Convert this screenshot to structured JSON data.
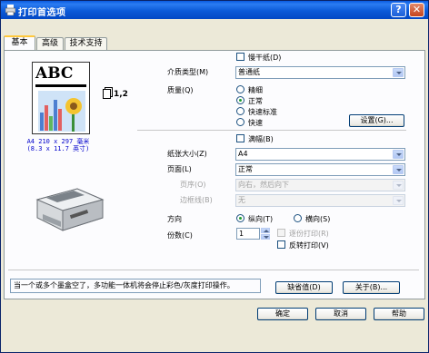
{
  "window": {
    "title": "打印首选项",
    "help_glyph": "?",
    "close_glyph": "✕"
  },
  "tabs": [
    {
      "label": "基本",
      "active": true
    },
    {
      "label": "高级"
    },
    {
      "label": "技术支持"
    }
  ],
  "preview": {
    "abc_text": "ABC",
    "copies_label": "1,2",
    "paper_size_line1": "A4 210 x 297 毫米",
    "paper_size_line2": "(8.3 x 11.7 英寸)"
  },
  "media": {
    "slow_dry_label": "慢干纸(D)",
    "media_type_label": "介质类型(M)",
    "media_type_value": "普通纸",
    "quality_label": "质量(Q)",
    "quality_options": [
      "精细",
      "正常",
      "快速标准",
      "快速"
    ],
    "quality_selected": "正常",
    "settings_button": "设置(G)..."
  },
  "paper": {
    "borderless_label": "满幅(B)",
    "paper_size_label": "纸张大小(Z)",
    "paper_size_value": "A4",
    "page_layout_label": "页面(L)",
    "page_layout_value": "正常",
    "page_order_label": "页序(O)",
    "page_order_value": "向右，然后向下",
    "border_line_label": "边框线(B)",
    "border_line_value": "无",
    "orientation_label": "方向",
    "orientation_portrait": "纵向(T)",
    "orientation_landscape": "横向(S)",
    "copies_label": "份数(C)",
    "copies_value": "1",
    "collate_label": "逐份打印(R)",
    "reverse_label": "反转打印(V)"
  },
  "status": {
    "message": "当一个或多个墨盒空了，多功能一体机将会停止彩色/灰度打印操作。"
  },
  "buttons": {
    "default": "缺省值(D)",
    "about": "关于(B)...",
    "ok": "确定",
    "cancel": "取消",
    "help": "帮助"
  },
  "colors": {
    "titlebar": "#0a5be0",
    "window_bg": "#ece9d8",
    "panel_bg": "#fcfcfe",
    "radio_dot": "#1f9e2f"
  }
}
